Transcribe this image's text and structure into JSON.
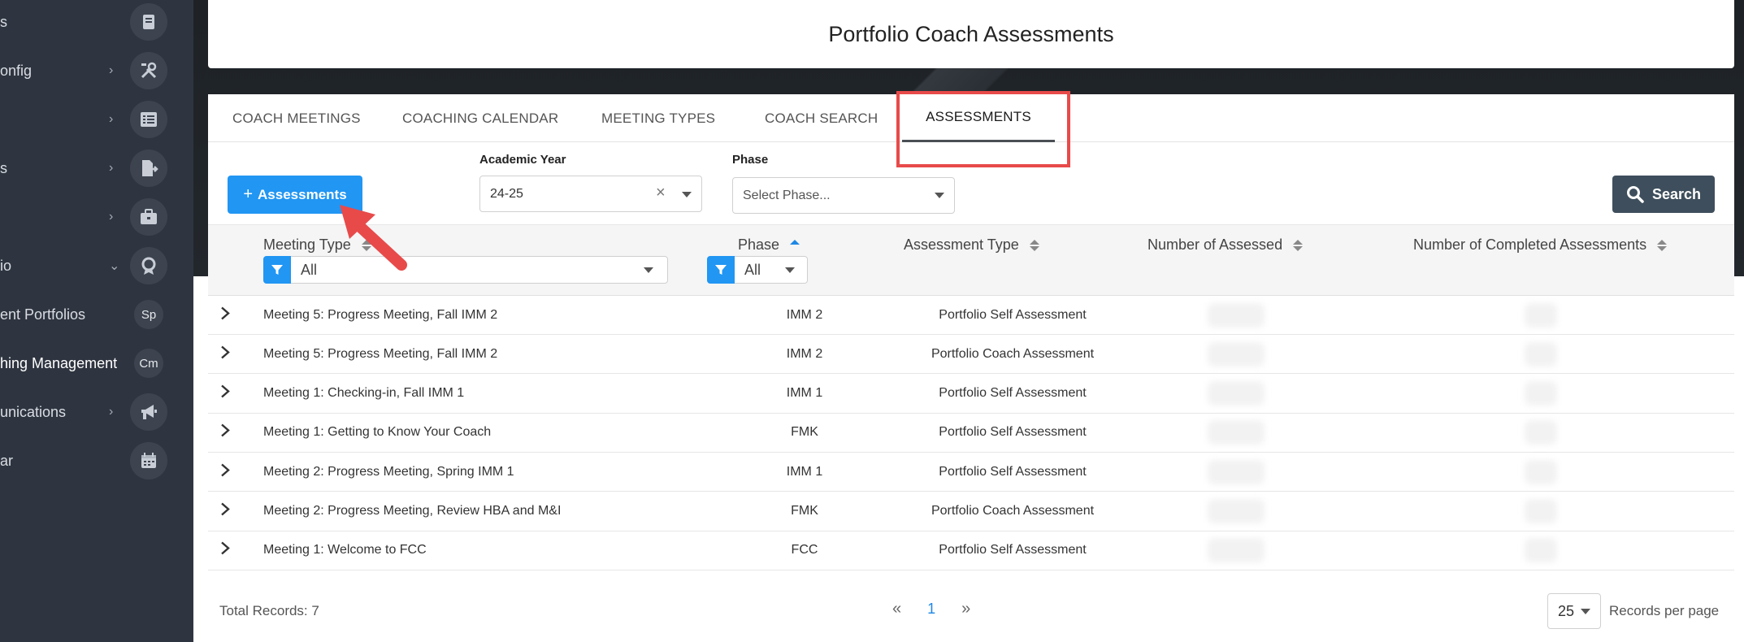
{
  "sidebar": {
    "items": [
      {
        "label": "s",
        "icon": "book-icon",
        "arrow": ""
      },
      {
        "label": "onfig",
        "icon": "tools-icon",
        "arrow": "›"
      },
      {
        "label": "",
        "icon": "list-icon",
        "arrow": "›"
      },
      {
        "label": "s",
        "icon": "file-export-icon",
        "arrow": "›"
      },
      {
        "label": "",
        "icon": "briefcase-icon",
        "arrow": "›"
      },
      {
        "label": "io",
        "icon": "award-icon",
        "arrow": "⌄"
      },
      {
        "label": "ent Portfolios",
        "abbr": "Sp"
      },
      {
        "label": "hing Management",
        "abbr": "Cm"
      },
      {
        "label": "unications",
        "icon": "megaphone-icon",
        "arrow": "›"
      },
      {
        "label": "ar",
        "icon": "calendar-icon",
        "arrow": ""
      }
    ]
  },
  "page": {
    "title": "Portfolio Coach Assessments"
  },
  "tabs": [
    {
      "label": "COACH MEETINGS"
    },
    {
      "label": "COACHING CALENDAR"
    },
    {
      "label": "MEETING TYPES"
    },
    {
      "label": "COACH SEARCH"
    },
    {
      "label": "ASSESSMENTS",
      "active": true
    }
  ],
  "filters": {
    "add_button": "Assessments",
    "academic_year_label": "Academic Year",
    "academic_year_value": "24-25",
    "phase_label": "Phase",
    "phase_placeholder": "Select Phase...",
    "search_button": "Search"
  },
  "table": {
    "headers": {
      "meeting_type": "Meeting Type",
      "phase": "Phase",
      "assessment_type": "Assessment Type",
      "number_assessed": "Number of Assessed",
      "number_completed": "Number of Completed Assessments"
    },
    "filter_meeting_type": "All",
    "filter_phase": "All",
    "rows": [
      {
        "meeting_type": "Meeting 5: Progress Meeting, Fall IMM 2",
        "phase": "IMM 2",
        "assessment_type": "Portfolio Self Assessment"
      },
      {
        "meeting_type": "Meeting 5: Progress Meeting, Fall IMM 2",
        "phase": "IMM 2",
        "assessment_type": "Portfolio Coach Assessment"
      },
      {
        "meeting_type": "Meeting 1: Checking-in, Fall IMM 1",
        "phase": "IMM 1",
        "assessment_type": "Portfolio Self Assessment"
      },
      {
        "meeting_type": "Meeting 1: Getting to Know Your Coach",
        "phase": "FMK",
        "assessment_type": "Portfolio Self Assessment"
      },
      {
        "meeting_type": "Meeting 2: Progress Meeting, Spring IMM 1",
        "phase": "IMM 1",
        "assessment_type": "Portfolio Self Assessment"
      },
      {
        "meeting_type": "Meeting 2: Progress Meeting, Review HBA and M&I",
        "phase": "FMK",
        "assessment_type": "Portfolio Coach Assessment"
      },
      {
        "meeting_type": "Meeting 1: Welcome to FCC",
        "phase": "FCC",
        "assessment_type": "Portfolio Self Assessment"
      }
    ]
  },
  "footer": {
    "total_records": "Total Records: 7",
    "current_page": "1",
    "per_page": "25",
    "per_page_label": "Records per page"
  },
  "colors": {
    "primary": "#2196f3",
    "search_button": "#3e4e5c",
    "highlight": "#e84a4a",
    "sidebar": "#2f3540"
  }
}
